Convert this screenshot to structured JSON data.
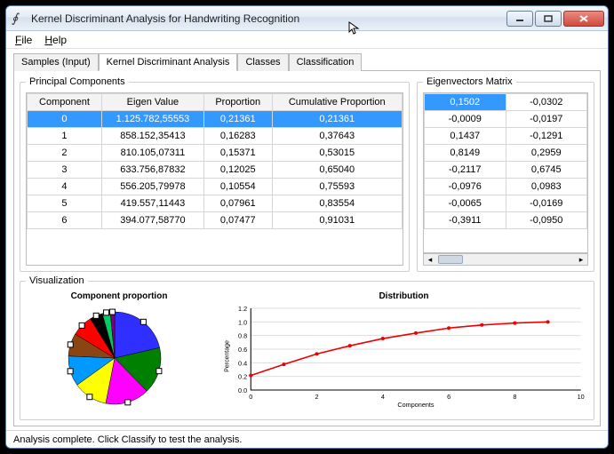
{
  "window": {
    "title": "Kernel Discriminant Analysis for Handwriting Recognition"
  },
  "menu": {
    "file": "File",
    "help": "Help"
  },
  "tabs": {
    "samples": "Samples (Input)",
    "kda": "Kernel Discriminant Analysis",
    "classes": "Classes",
    "classification": "Classification"
  },
  "labels": {
    "pc": "Principal Components",
    "eig": "Eigenvectors Matrix",
    "viz": "Visualization",
    "comp_prop": "Component proportion",
    "dist": "Distribution"
  },
  "pc_headers": {
    "component": "Component",
    "eigen": "Eigen Value",
    "prop": "Proportion",
    "cum": "Cumulative Proportion"
  },
  "pc_rows": [
    {
      "c": "0",
      "e": "1.125.782,55553",
      "p": "0,21361",
      "cp": "0,21361"
    },
    {
      "c": "1",
      "e": "858.152,35413",
      "p": "0,16283",
      "cp": "0,37643"
    },
    {
      "c": "2",
      "e": "810.105,07311",
      "p": "0,15371",
      "cp": "0,53015"
    },
    {
      "c": "3",
      "e": "633.756,87832",
      "p": "0,12025",
      "cp": "0,65040"
    },
    {
      "c": "4",
      "e": "556.205,79978",
      "p": "0,10554",
      "cp": "0,75593"
    },
    {
      "c": "5",
      "e": "419.557,11443",
      "p": "0,07961",
      "cp": "0,83554"
    },
    {
      "c": "6",
      "e": "394.077,58770",
      "p": "0,07477",
      "cp": "0,91031"
    }
  ],
  "eig_rows": [
    [
      "0,1502",
      "-0,0302"
    ],
    [
      "-0,0009",
      "-0,0197"
    ],
    [
      "0,1437",
      "-0,1291"
    ],
    [
      "0,8149",
      "0,2959"
    ],
    [
      "-0,2117",
      "0,6745"
    ],
    [
      "-0,0976",
      "0,0983"
    ],
    [
      "-0,0065",
      "-0,0169"
    ],
    [
      "-0,3911",
      "-0,0950"
    ]
  ],
  "status": "Analysis complete. Click Classify to test the analysis.",
  "chart_data": [
    {
      "type": "pie",
      "title": "Component proportion",
      "categories": [
        "0",
        "1",
        "2",
        "3",
        "4",
        "5",
        "6",
        "7",
        "8",
        "9"
      ],
      "values": [
        0.214,
        0.163,
        0.154,
        0.12,
        0.106,
        0.08,
        0.075,
        0.045,
        0.028,
        0.015
      ],
      "colors": [
        "#2f2fff",
        "#008000",
        "#ff00ff",
        "#ffff00",
        "#0099ff",
        "#8b4513",
        "#ff0000",
        "#000000",
        "#00cc66",
        "#800080"
      ]
    },
    {
      "type": "line",
      "title": "Distribution",
      "xlabel": "Components",
      "ylabel": "Percentage",
      "xlim": [
        0,
        10
      ],
      "ylim": [
        0,
        1.2
      ],
      "x": [
        0,
        1,
        2,
        3,
        4,
        5,
        6,
        7,
        8,
        9
      ],
      "values": [
        0.214,
        0.376,
        0.53,
        0.65,
        0.756,
        0.836,
        0.91,
        0.955,
        0.983,
        1.0
      ]
    }
  ]
}
